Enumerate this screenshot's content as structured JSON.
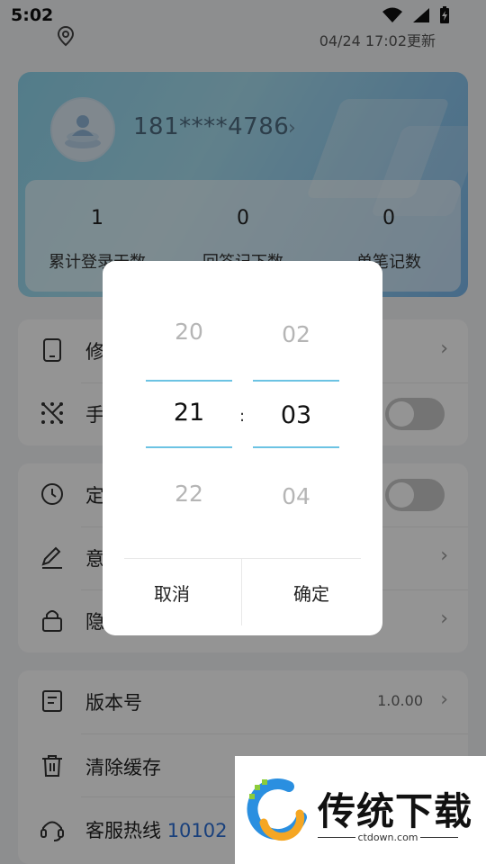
{
  "status_bar": {
    "time": "5:02"
  },
  "location_bar": {
    "update_text": "04/24 17:02更新"
  },
  "profile": {
    "phone": "181****4786",
    "chevron": "›"
  },
  "stats": [
    {
      "value": "1",
      "label": "累计登录天数"
    },
    {
      "value": "0",
      "label": "回答记下数"
    },
    {
      "value": "0",
      "label": "单笔记数"
    }
  ],
  "group1": [
    {
      "label": "修",
      "icon": "phone-icon",
      "chevron": "›"
    },
    {
      "label": "手",
      "icon": "gesture-icon",
      "toggle_on": false
    }
  ],
  "group2": [
    {
      "label": "定",
      "icon": "clock-icon",
      "toggle_on": false
    },
    {
      "label": "意",
      "icon": "pencil-icon",
      "chevron": "›"
    },
    {
      "label": "隐",
      "icon": "lock-icon",
      "chevron": "›"
    }
  ],
  "group3": [
    {
      "label": "版本号",
      "value": "1.0.00",
      "icon": "document-icon",
      "chevron": "›"
    },
    {
      "label": "清除缓存",
      "icon": "trash-icon"
    },
    {
      "label": "客服热线",
      "number": "10102",
      "icon": "headset-icon"
    }
  ],
  "time_picker": {
    "hours": {
      "prev": "20",
      "selected": "21",
      "next": "22"
    },
    "separator": ":",
    "minutes": {
      "prev": "02",
      "selected": "03",
      "next": "04"
    },
    "cancel_label": "取消",
    "confirm_label": "确定",
    "accent_color": "#6cc3e3"
  },
  "watermark": {
    "title": "传统下载",
    "url": "ctdown.com"
  }
}
